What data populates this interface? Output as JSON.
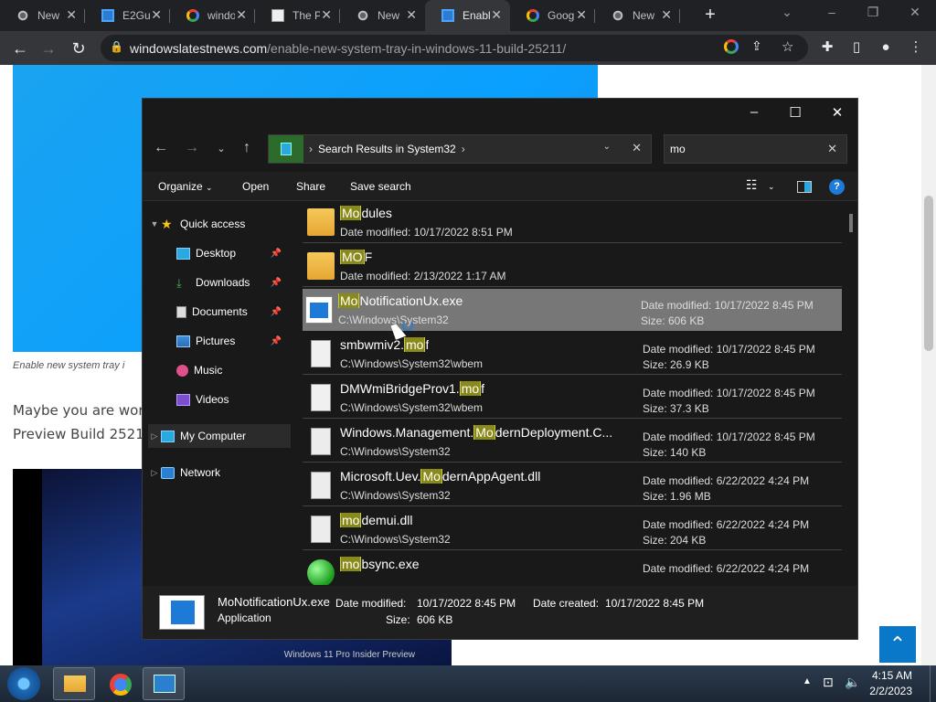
{
  "browser": {
    "tabs": [
      {
        "title": "New",
        "favicon": "chrome-icon"
      },
      {
        "title": "E2Gu",
        "favicon": "windows-icon"
      },
      {
        "title": "windo",
        "favicon": "google-icon"
      },
      {
        "title": "The P",
        "favicon": "news-icon"
      },
      {
        "title": "New",
        "favicon": "chrome-icon"
      },
      {
        "title": "Enabl",
        "favicon": "windows-icon"
      },
      {
        "title": "Goog",
        "favicon": "google-icon"
      },
      {
        "title": "New",
        "favicon": "chrome-icon"
      }
    ],
    "url_host": "windowslatestnews.com",
    "url_path": "/enable-new-system-tray-in-windows-11-build-25211/"
  },
  "page": {
    "caption": "Enable new system tray i",
    "para_line1": "Maybe you are wor",
    "para_line2": "Preview Build 2521",
    "img2_watermark1": "Windows 11 Pro Insider Preview"
  },
  "explorer": {
    "breadcrumb": "Search Results in System32",
    "search_value": "mo",
    "commands": {
      "organize": "Organize",
      "open": "Open",
      "share": "Share",
      "save_search": "Save search"
    },
    "nav": {
      "quick_access": "Quick access",
      "desktop": "Desktop",
      "downloads": "Downloads",
      "documents": "Documents",
      "pictures": "Pictures",
      "music": "Music",
      "videos": "Videos",
      "my_computer": "My Computer",
      "network": "Network"
    },
    "files": [
      {
        "pre": "",
        "match": "Mo",
        "post": "dules",
        "sub": "Date modified: 10/17/2022 8:51 PM",
        "date": "",
        "size": "",
        "icon": "folder-icon"
      },
      {
        "pre": "",
        "match": "MO",
        "post": "F",
        "sub": "Date modified: 2/13/2022 1:17 AM",
        "date": "",
        "size": "",
        "icon": "folder-icon"
      },
      {
        "pre": "",
        "match": "Mo",
        "post": "NotificationUx.exe",
        "sub": "C:\\Windows\\System32",
        "date": "Date modified: 10/17/2022 8:45 PM",
        "size": "Size: 606 KB",
        "icon": "exe-icon"
      },
      {
        "pre": "smbwmiv2.",
        "match": "mo",
        "post": "f",
        "sub": "C:\\Windows\\System32\\wbem",
        "date": "Date modified: 10/17/2022 8:45 PM",
        "size": "Size: 26.9 KB",
        "icon": "document-icon"
      },
      {
        "pre": "DMWmiBridgeProv1.",
        "match": "mo",
        "post": "f",
        "sub": "C:\\Windows\\System32\\wbem",
        "date": "Date modified: 10/17/2022 8:45 PM",
        "size": "Size: 37.3 KB",
        "icon": "document-icon"
      },
      {
        "pre": "Windows.Management.",
        "match": "Mo",
        "post": "dernDeployment.C...",
        "sub": "C:\\Windows\\System32",
        "date": "Date modified: 10/17/2022 8:45 PM",
        "size": "Size: 140 KB",
        "icon": "dll-gear-icon"
      },
      {
        "pre": "Microsoft.Uev.",
        "match": "Mo",
        "post": "dernAppAgent.dll",
        "sub": "C:\\Windows\\System32",
        "date": "Date modified: 6/22/2022 4:24 PM",
        "size": "Size: 1.96 MB",
        "icon": "dll-gear-icon"
      },
      {
        "pre": "",
        "match": "mo",
        "post": "demui.dll",
        "sub": "C:\\Windows\\System32",
        "date": "Date modified: 6/22/2022 4:24 PM",
        "size": "Size: 204 KB",
        "icon": "dll-gear-icon"
      },
      {
        "pre": "",
        "match": "mo",
        "post": "bsync.exe",
        "sub": "",
        "date": "Date modified: 6/22/2022 4:24 PM",
        "size": "",
        "icon": "sync-icon"
      }
    ],
    "details": {
      "name": "MoNotificationUx.exe",
      "type": "Application",
      "date_modified_label": "Date modified:",
      "date_modified": "10/17/2022 8:45 PM",
      "size_label": "Size:",
      "size": "606 KB",
      "date_created_label": "Date created:",
      "date_created": "10/17/2022 8:45 PM"
    }
  },
  "taskbar": {
    "time": "4:15 AM",
    "date": "2/2/2023"
  }
}
